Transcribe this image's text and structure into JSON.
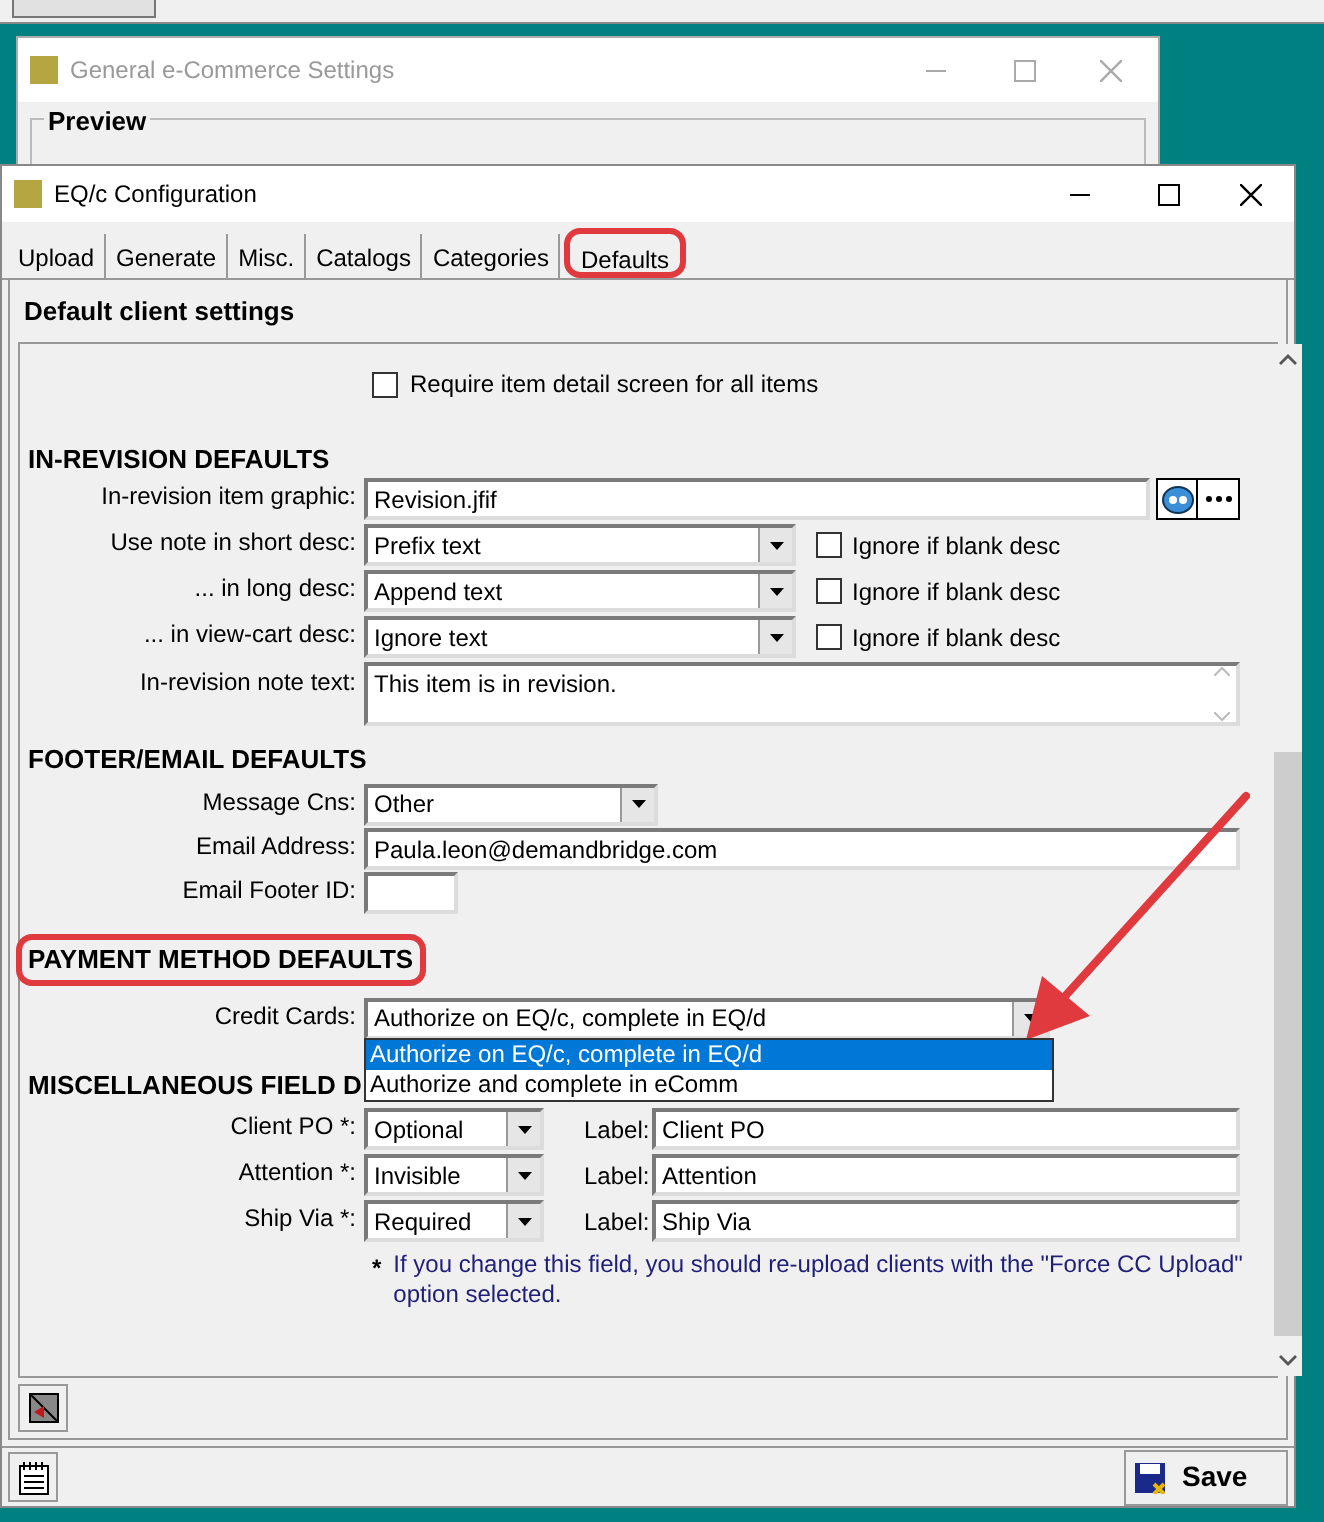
{
  "background_window": {
    "title": "General e-Commerce Settings",
    "group_label": "Preview"
  },
  "window": {
    "title": "EQ/c Configuration",
    "tabs": [
      {
        "label": "Upload",
        "selected": false,
        "circled": false
      },
      {
        "label": "Generate",
        "selected": false,
        "circled": false
      },
      {
        "label": "Misc.",
        "selected": false,
        "circled": false
      },
      {
        "label": "Catalogs",
        "selected": false,
        "circled": false
      },
      {
        "label": "Categories",
        "selected": false,
        "circled": false
      },
      {
        "label": "Defaults",
        "selected": true,
        "circled": true
      }
    ],
    "panel_heading": "Default client settings",
    "require_detail": {
      "label": "Require item detail screen for all items",
      "checked": false
    },
    "in_revision": {
      "heading": "IN-REVISION DEFAULTS",
      "circled": false,
      "graphic": {
        "label": "In-revision item graphic:",
        "value": "Revision.jfif"
      },
      "desc_rows": [
        {
          "label": "Use note in short desc:",
          "value": "Prefix text",
          "ignore_label": "Ignore if blank desc",
          "checked": false
        },
        {
          "label": "... in long desc:",
          "value": "Append text",
          "ignore_label": "Ignore if blank desc",
          "checked": false
        },
        {
          "label": "... in view-cart desc:",
          "value": "Ignore text",
          "ignore_label": "Ignore if blank desc",
          "checked": false
        }
      ],
      "note": {
        "label": "In-revision note text:",
        "value": "This item is in revision."
      }
    },
    "footer_email": {
      "heading": "FOOTER/EMAIL DEFAULTS",
      "circled": false,
      "message_cns": {
        "label": "Message Cns:",
        "value": "Other"
      },
      "email": {
        "label": "Email Address:",
        "value": "Paula.leon@demandbridge.com"
      },
      "footer_id": {
        "label": "Email Footer ID:"
      }
    },
    "payment": {
      "heading": "PAYMENT METHOD DEFAULTS",
      "circled": true,
      "credit_cards": {
        "label": "Credit Cards:",
        "value": "Authorize on EQ/c, complete in EQ/d",
        "expanded": true,
        "options": [
          {
            "label": "Authorize on EQ/c, complete in EQ/d",
            "selected": true
          },
          {
            "label": "Authorize and complete in eComm",
            "selected": false
          }
        ]
      }
    },
    "misc": {
      "heading": "MISCELLANEOUS FIELD D",
      "rows": [
        {
          "label": "Client PO *:",
          "value": "Optional",
          "caption_label": "Label:",
          "caption_value": "Client PO"
        },
        {
          "label": "Attention *:",
          "value": "Invisible",
          "caption_label": "Label:",
          "caption_value": "Attention"
        },
        {
          "label": "Ship Via *:",
          "value": "Required",
          "caption_label": "Label:",
          "caption_value": "Ship Via"
        }
      ],
      "note_marker": "*",
      "note": "If you change this field, you should re-upload clients with the \"Force CC Upload\" option selected."
    },
    "save_label": "Save"
  }
}
